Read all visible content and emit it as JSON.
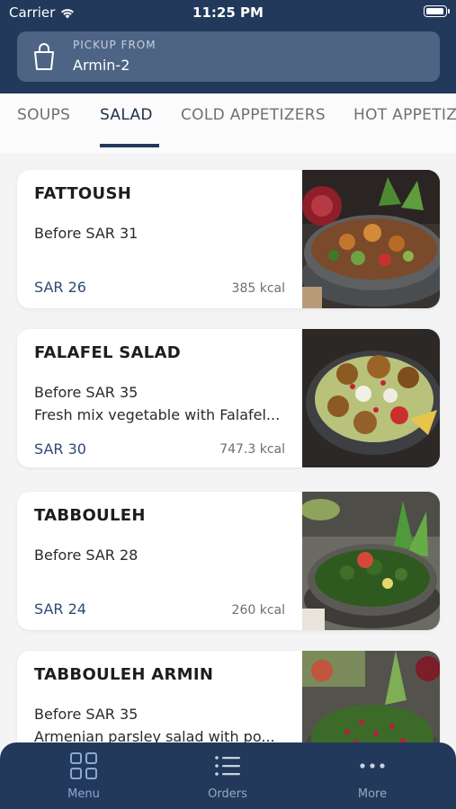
{
  "status_bar": {
    "carrier": "Carrier",
    "time": "11:25 PM"
  },
  "pickup": {
    "label": "PICKUP FROM",
    "value": "Armin-2"
  },
  "categories": [
    {
      "label": "SOUPS",
      "active": false
    },
    {
      "label": "SALAD",
      "active": true
    },
    {
      "label": "COLD APPETIZERS",
      "active": false
    },
    {
      "label": "HOT APPETIZ",
      "active": false
    }
  ],
  "items": [
    {
      "name": "FATTOUSH",
      "before": "Before SAR 31",
      "desc": "",
      "price": "SAR 26",
      "kcal": "385 kcal",
      "photo": "fattoush-salad-image"
    },
    {
      "name": "FALAFEL SALAD",
      "before": "Before SAR 35",
      "desc": "Fresh mix vegetable with Falafel...",
      "price": "SAR 30",
      "kcal": "747.3 kcal",
      "photo": "falafel-salad-image"
    },
    {
      "name": "TABBOULEH",
      "before": "Before SAR 28",
      "desc": "",
      "price": "SAR 24",
      "kcal": "260 kcal",
      "photo": "tabbouleh-image"
    },
    {
      "name": "TABBOULEH ARMIN",
      "before": "Before SAR 35",
      "desc": "Armenian parsley salad with po...",
      "price": "",
      "kcal": "",
      "photo": "tabbouleh-armin-image"
    }
  ],
  "tabbar": [
    {
      "label": "Menu",
      "icon": "grid-icon",
      "active": true
    },
    {
      "label": "Orders",
      "icon": "list-icon",
      "active": false
    },
    {
      "label": "More",
      "icon": "more-dots-icon",
      "active": false
    }
  ],
  "colors": {
    "navy": "#22395b",
    "pickup_box": "#4d6485",
    "price": "#2d4a73",
    "menu_icon": "#8aa8d6"
  }
}
